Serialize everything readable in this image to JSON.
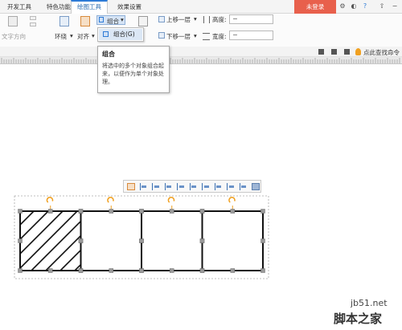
{
  "menubar": {
    "tabs": [
      {
        "label": "开发工具",
        "active": false
      },
      {
        "label": "特色功能",
        "active": false
      },
      {
        "label": "绘图工具",
        "active": true
      },
      {
        "label": "效果设置",
        "active": false
      }
    ],
    "login_label": "未登录",
    "accent_color": "#2e7bd6",
    "login_color": "#e8604c"
  },
  "ribbon": {
    "text_direction": "文字方向",
    "wrap": "环绕",
    "align": "对齐",
    "group": "组合",
    "bring_forward": "上移一层",
    "send_backward": "下移一层",
    "height_label": "高度:",
    "width_label": "宽度:",
    "height_value": "−",
    "width_value": "−",
    "find_command": "点此查找命令"
  },
  "dropdown": {
    "items": [
      {
        "label": "组合(G)",
        "highlighted": true
      }
    ]
  },
  "tooltip": {
    "title": "组合",
    "body": "将选中的多个对象组合起来，以便作为单个对象处理。"
  },
  "shapes": {
    "count": 4,
    "hatched_index": 0,
    "selected": true
  },
  "watermark": {
    "url": "jb51.net",
    "name": "脚本之家"
  }
}
